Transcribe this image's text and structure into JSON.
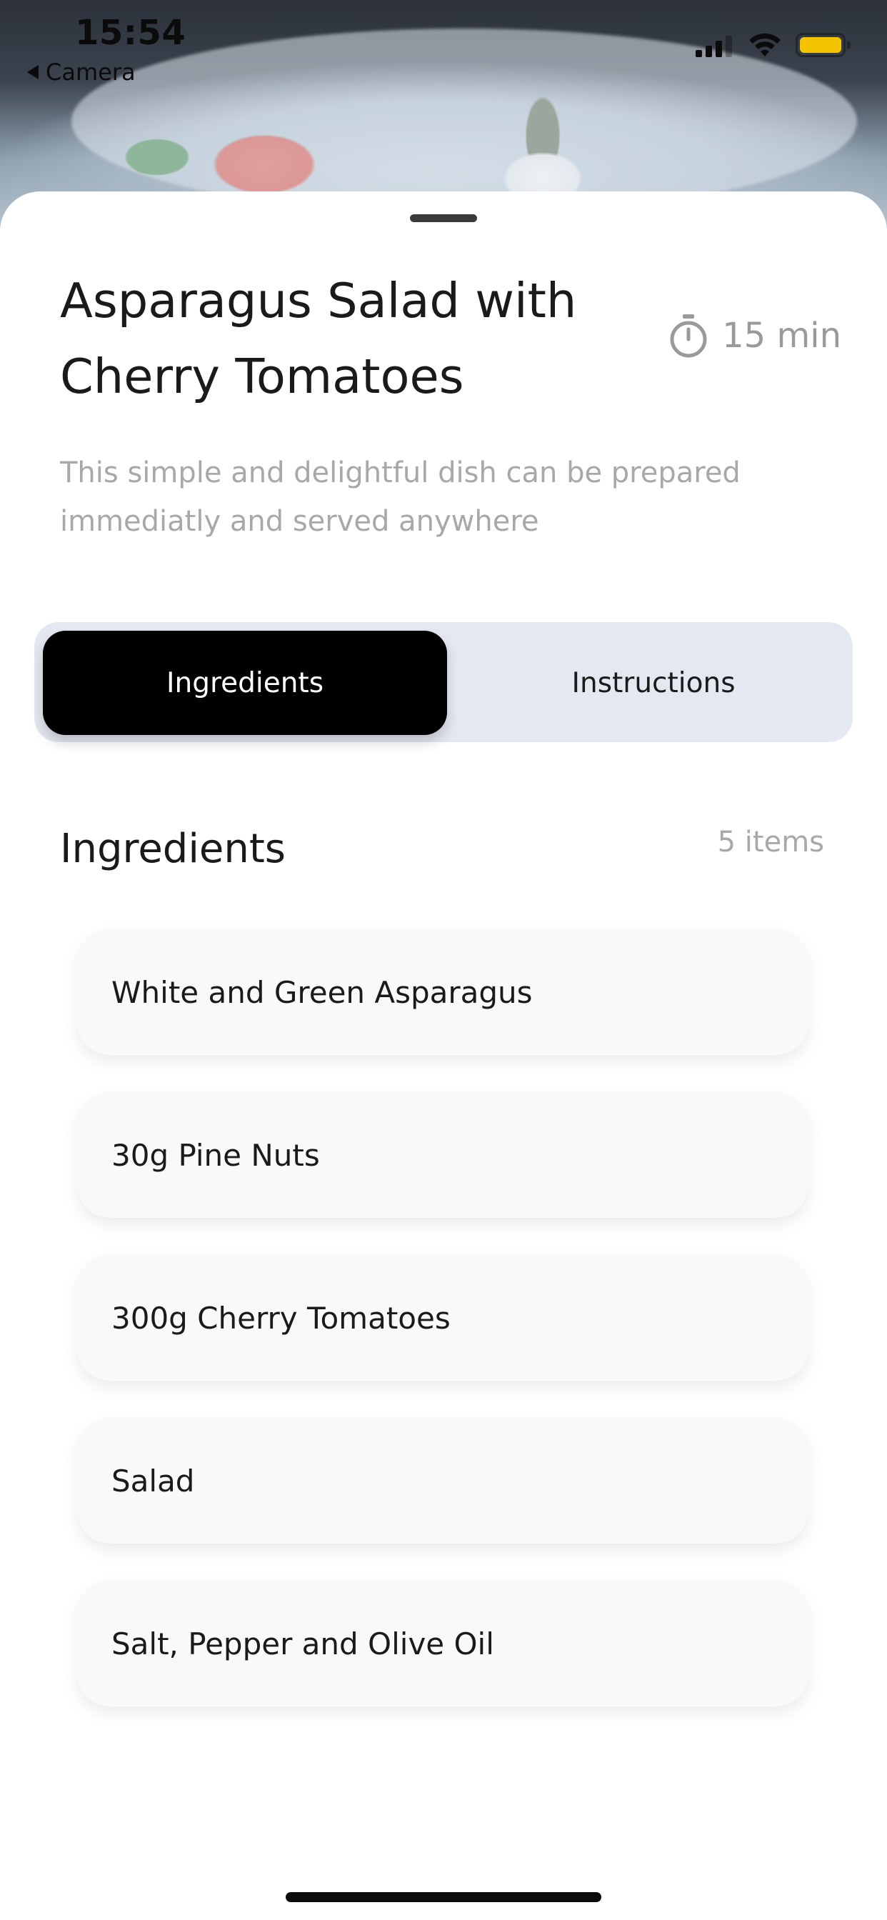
{
  "status_bar": {
    "time": "15:54",
    "back_label": "Camera"
  },
  "recipe": {
    "title": "Asparagus Salad with Cherry Tomatoes",
    "duration": "15 min",
    "description": "This simple and delightful dish can be prepared immediatly and served anywhere"
  },
  "tabs": {
    "active": "Ingredients",
    "inactive": "Instructions"
  },
  "ingredients": {
    "heading": "Ingredients",
    "count": "5 items",
    "items": [
      "White and Green Asparagus",
      "30g Pine Nuts",
      "300g Cherry Tomatoes",
      "Salad",
      "Salt, Pepper and Olive Oil"
    ]
  },
  "colors": {
    "accent": "#000000",
    "segment_background": "#e4e8f0",
    "muted_text": "#a8a8a8",
    "battery": "#f4c400"
  },
  "icons": {
    "timer": "stopwatch-icon",
    "wifi": "wifi-icon",
    "signal": "cellular-signal-icon",
    "battery": "battery-icon",
    "back": "back-triangle-icon"
  }
}
